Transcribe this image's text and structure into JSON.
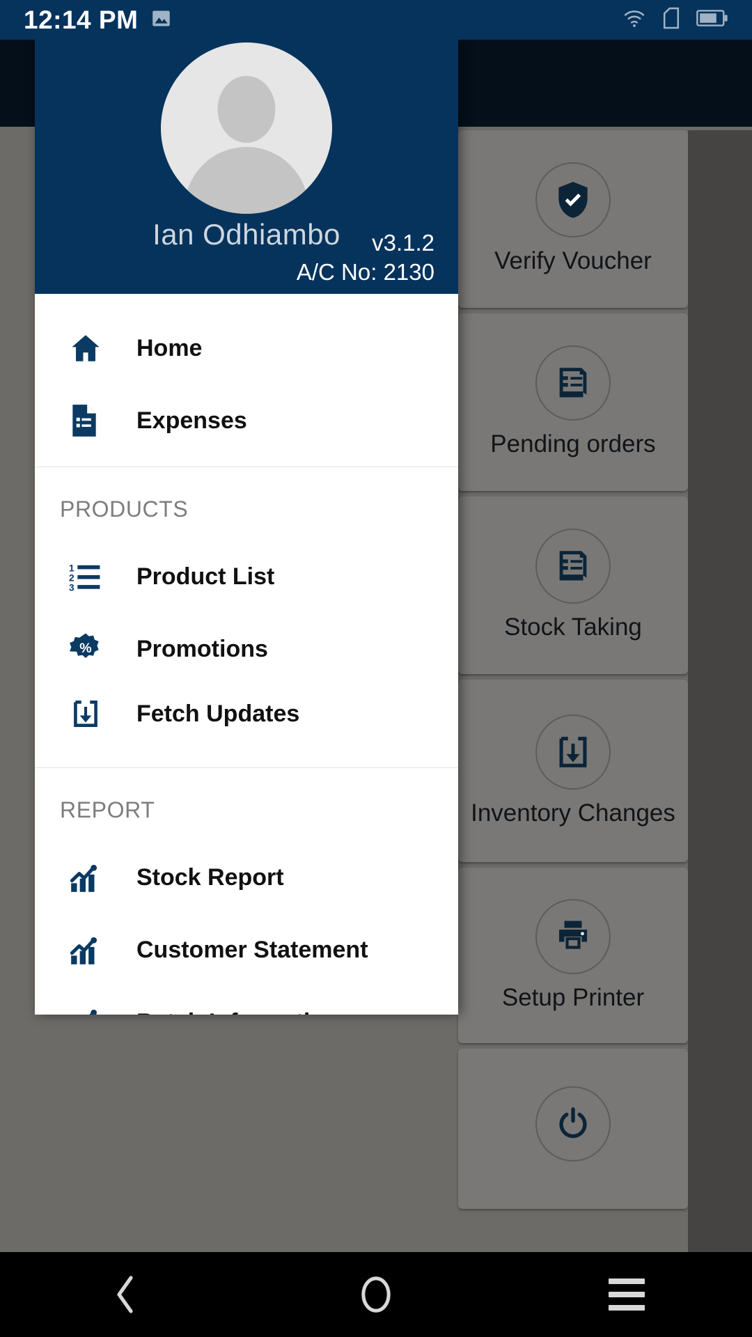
{
  "status_bar": {
    "time": "12:14 PM",
    "icons": [
      "image-icon",
      "wifi-icon",
      "sim-card-icon",
      "battery-icon"
    ]
  },
  "drawer": {
    "profile": {
      "name": "Ian  Odhiambo",
      "avatar": "default-person-avatar",
      "app_version": "v3.1.2",
      "account_no": "A/C No: 2130"
    },
    "primary_items": [
      {
        "label": "Home",
        "icon": "home-icon"
      },
      {
        "label": "Expenses",
        "icon": "receipt-document-icon"
      }
    ],
    "sections": [
      {
        "title": "PRODUCTS",
        "items": [
          {
            "label": "Product List",
            "icon": "numbered-list-icon"
          },
          {
            "label": "Promotions",
            "icon": "percent-badge-icon"
          },
          {
            "label": "Fetch Updates",
            "icon": "download-tray-icon"
          }
        ]
      },
      {
        "title": "REPORT",
        "items": [
          {
            "label": "Stock Report",
            "icon": "bar-chart-trend-icon"
          },
          {
            "label": "Customer Statement",
            "icon": "bar-chart-trend-icon"
          },
          {
            "label": "Batch Information",
            "icon": "bar-chart-trend-icon"
          }
        ]
      }
    ]
  },
  "background_app": {
    "cards": [
      {
        "label": "Verify Voucher",
        "icon": "shield-check-icon"
      },
      {
        "label": "Pending orders",
        "icon": "receipt-list-icon"
      },
      {
        "label": "Stock Taking",
        "icon": "receipt-list-icon"
      },
      {
        "label": "Inventory Changes",
        "icon": "download-tray-icon"
      },
      {
        "label": "Setup Printer",
        "icon": "printer-icon"
      },
      {
        "label": "Logout",
        "icon": "power-icon"
      }
    ]
  },
  "nav_bar": {
    "back_label": "Back",
    "home_label": "Home",
    "recents_label": "Recents"
  },
  "colors": {
    "brand_navy": "#05335c",
    "icon_navy": "#0b3a63",
    "drawer_bg": "#ffffff",
    "section_text": "#7d7d7d",
    "scrim": "#6d6b68"
  }
}
